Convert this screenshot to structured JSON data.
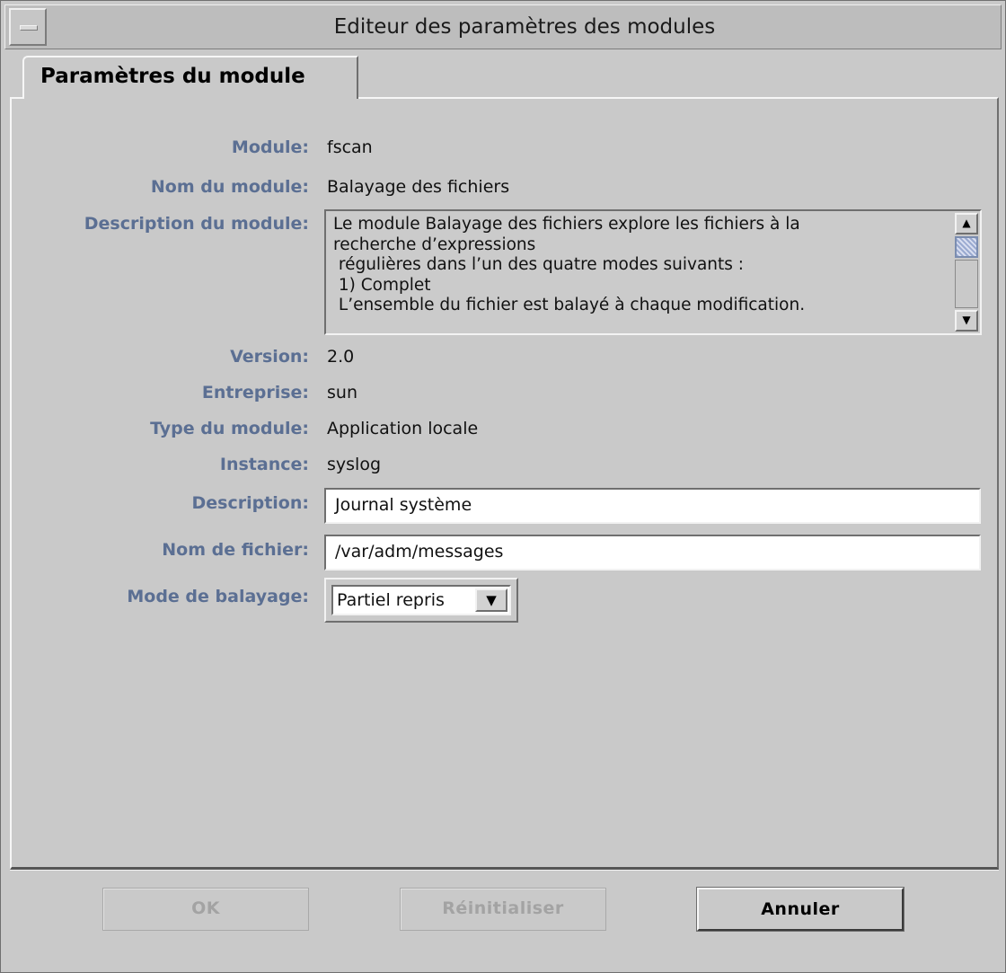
{
  "window": {
    "title": "Editeur des paramètres des modules"
  },
  "tabs": [
    {
      "label": "Paramètres du module",
      "selected": true
    }
  ],
  "fields": {
    "module": {
      "label": "Module:",
      "value": "fscan"
    },
    "module_name": {
      "label": "Nom du module:",
      "value": "Balayage des fichiers"
    },
    "module_description": {
      "label": "Description du module:",
      "value": "Le module Balayage des fichiers explore les fichiers à la\nrecherche d’expressions\n régulières dans l’un des quatre modes suivants :\n 1) Complet\n L’ensemble du fichier est balayé à chaque modification."
    },
    "version": {
      "label": "Version:",
      "value": "2.0"
    },
    "enterprise": {
      "label": "Entreprise:",
      "value": "sun"
    },
    "module_type": {
      "label": "Type du module:",
      "value": "Application locale"
    },
    "instance": {
      "label": "Instance:",
      "value": "syslog"
    },
    "description": {
      "label": "Description:",
      "value": "Journal système"
    },
    "filename": {
      "label": "Nom de fichier:",
      "value": "/var/adm/messages"
    },
    "scan_mode": {
      "label": "Mode de balayage:",
      "value": "Partiel repris"
    }
  },
  "buttons": {
    "ok": {
      "label": "OK",
      "enabled": false
    },
    "reset": {
      "label": "Réinitialiser",
      "enabled": false
    },
    "cancel": {
      "label": "Annuler",
      "enabled": true
    }
  },
  "colors": {
    "background": "#c9c9c9",
    "label": "#5b6f93",
    "scroll_thumb": "#9aaad0"
  },
  "icons": {
    "window_menu": "window-menu-icon",
    "scroll_up": "arrow-up-icon",
    "scroll_down": "arrow-down-icon",
    "combo_open": "arrow-down-icon"
  }
}
